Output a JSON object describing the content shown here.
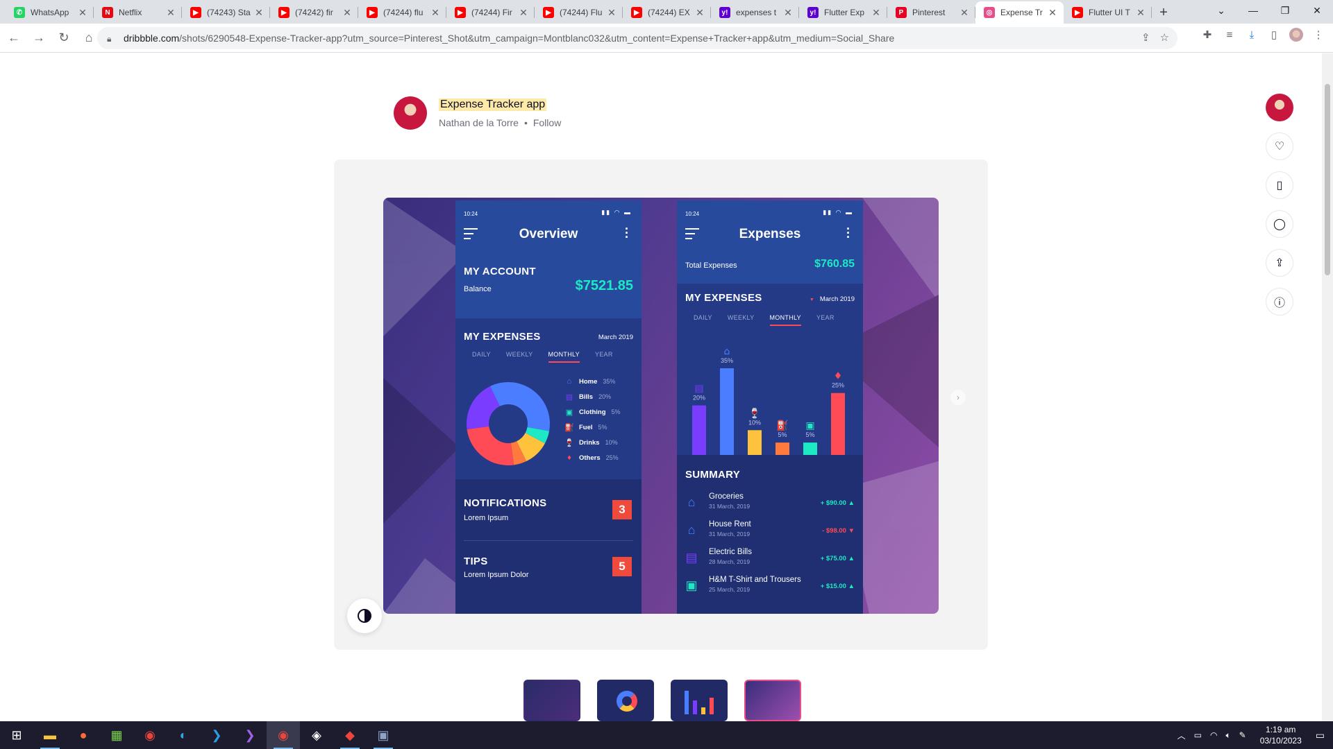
{
  "browser": {
    "tabs": [
      {
        "title": "WhatsApp",
        "icon": "whatsapp-icon",
        "color": "#25d366",
        "glyph": "✆"
      },
      {
        "title": "Netflix",
        "icon": "netflix-icon",
        "color": "#e50914",
        "glyph": "N"
      },
      {
        "title": "(74243) Sta",
        "icon": "youtube-icon",
        "color": "#ff0000",
        "glyph": "▶"
      },
      {
        "title": "(74242) fir",
        "icon": "youtube-icon",
        "color": "#ff0000",
        "glyph": "▶"
      },
      {
        "title": "(74244) flu",
        "icon": "youtube-icon",
        "color": "#ff0000",
        "glyph": "▶"
      },
      {
        "title": "(74244) Fir",
        "icon": "youtube-icon",
        "color": "#ff0000",
        "glyph": "▶"
      },
      {
        "title": "(74244) Flu",
        "icon": "youtube-icon",
        "color": "#ff0000",
        "glyph": "▶"
      },
      {
        "title": "(74244) EX",
        "icon": "youtube-icon",
        "color": "#ff0000",
        "glyph": "▶"
      },
      {
        "title": "expenses t",
        "icon": "yahoo-icon",
        "color": "#5f01d1",
        "glyph": "y!"
      },
      {
        "title": "Flutter Exp",
        "icon": "yahoo-icon",
        "color": "#5f01d1",
        "glyph": "y!"
      },
      {
        "title": "Pinterest",
        "icon": "pinterest-icon",
        "color": "#e60023",
        "glyph": "P"
      },
      {
        "title": "Expense Tr",
        "icon": "dribbble-icon",
        "color": "#ea4c89",
        "glyph": "◎",
        "active": true
      },
      {
        "title": "Flutter UI T",
        "icon": "youtube-icon",
        "color": "#ff0000",
        "glyph": "▶"
      }
    ],
    "url_host": "dribbble.com",
    "url_path": "/shots/6290548-Expense-Tracker-app?utm_source=Pinterest_Shot&utm_campaign=Montblanc032&utm_content=Expense+Tracker+app&utm_medium=Social_Share"
  },
  "shot": {
    "title": "Expense Tracker app",
    "author": "Nathan de la Torre",
    "follow": "Follow"
  },
  "overview": {
    "status_time": "10:24",
    "title": "Overview",
    "account_heading": "MY ACCOUNT",
    "balance_label": "Balance",
    "balance_value": "$7521.85",
    "expenses_heading": "MY EXPENSES",
    "period": "March 2019",
    "tabs": [
      "DAILY",
      "WEEKLY",
      "MONTHLY",
      "YEAR"
    ],
    "legend": [
      {
        "name": "Home",
        "pct": "35%",
        "icon": "home-icon",
        "glyph": "⌂",
        "color": "#4a7dff"
      },
      {
        "name": "Bills",
        "pct": "20%",
        "icon": "bills-icon",
        "glyph": "▤",
        "color": "#7a3cff"
      },
      {
        "name": "Clothing",
        "pct": "5%",
        "icon": "clothing-icon",
        "glyph": "▣",
        "color": "#1de9c4"
      },
      {
        "name": "Fuel",
        "pct": "5%",
        "icon": "fuel-icon",
        "glyph": "⛽",
        "color": "#ff7a3c"
      },
      {
        "name": "Drinks",
        "pct": "10%",
        "icon": "drinks-icon",
        "glyph": "🍷",
        "color": "#ffc23c"
      },
      {
        "name": "Others",
        "pct": "25%",
        "icon": "others-icon",
        "glyph": "♦",
        "color": "#ff4b55"
      }
    ],
    "notifications_heading": "NOTIFICATIONS",
    "notifications_text": "Lorem Ipsum",
    "notifications_count": "3",
    "tips_heading": "TIPS",
    "tips_text": "Lorem Ipsum Dolor",
    "tips_count": "5"
  },
  "expenses": {
    "status_time": "10:24",
    "title": "Expenses",
    "total_label": "Total Expenses",
    "total_value": "$760.85",
    "heading": "MY EXPENSES",
    "period": "March 2019",
    "tabs": [
      "DAILY",
      "WEEKLY",
      "MONTHLY",
      "YEAR"
    ],
    "summary_heading": "SUMMARY",
    "summary": [
      {
        "name": "Groceries",
        "date": "31 March, 2019",
        "amount": "+ $90.00 ▲",
        "color": "#1de9c4",
        "icon": "home-icon",
        "glyph": "⌂",
        "icolor": "#4a7dff"
      },
      {
        "name": "House Rent",
        "date": "31 March, 2019",
        "amount": "- $98.00 ▼",
        "color": "#ff4b55",
        "icon": "home-icon",
        "glyph": "⌂",
        "icolor": "#4a7dff"
      },
      {
        "name": "Electric Bills",
        "date": "28 March, 2019",
        "amount": "+ $75.00 ▲",
        "color": "#1de9c4",
        "icon": "bills-icon",
        "glyph": "▤",
        "icolor": "#7a3cff"
      },
      {
        "name": "H&M T-Shirt and Trousers",
        "date": "25 March, 2019",
        "amount": "+ $15.00 ▲",
        "color": "#1de9c4",
        "icon": "clothing-icon",
        "glyph": "▣",
        "icolor": "#1de9c4"
      }
    ]
  },
  "chart_data": [
    {
      "type": "pie",
      "title": "",
      "categories": [
        "Home",
        "Clothing",
        "Drinks",
        "Fuel",
        "Others",
        "Bills"
      ],
      "values": [
        35,
        5,
        10,
        5,
        25,
        20
      ],
      "colors": [
        "#4a7dff",
        "#1de9c4",
        "#ffc23c",
        "#ff7a3c",
        "#ff4b55",
        "#7a3cff"
      ],
      "donut": true
    },
    {
      "type": "bar",
      "title": "",
      "categories": [
        "Bills",
        "Home",
        "Drinks",
        "Fuel",
        "Clothing",
        "Others"
      ],
      "values": [
        20,
        35,
        10,
        5,
        5,
        25
      ],
      "labels": [
        "20%",
        "35%",
        "10%",
        "5%",
        "5%",
        "25%"
      ],
      "colors": [
        "#7a3cff",
        "#4a7dff",
        "#ffc23c",
        "#ff7a3c",
        "#1de9c4",
        "#ff4b55"
      ],
      "ylim": [
        0,
        35
      ]
    }
  ],
  "taskbar": {
    "time": "1:19 am",
    "date": "03/10/2023"
  }
}
